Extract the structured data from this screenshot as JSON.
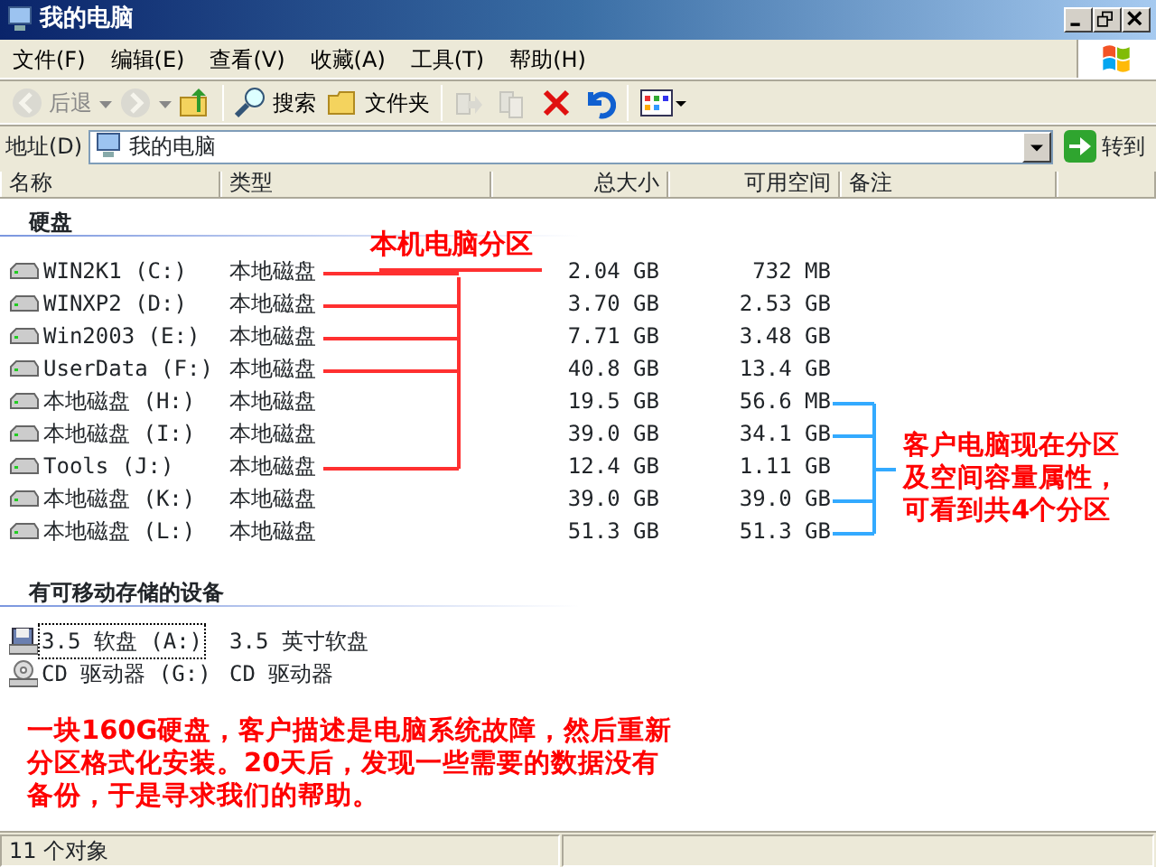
{
  "window": {
    "title": "我的电脑"
  },
  "menu": [
    {
      "label": "文件(F)"
    },
    {
      "label": "编辑(E)"
    },
    {
      "label": "查看(V)"
    },
    {
      "label": "收藏(A)"
    },
    {
      "label": "工具(T)"
    },
    {
      "label": "帮助(H)"
    }
  ],
  "toolbar": [
    {
      "kind": "back",
      "label": "后退",
      "disabled": true
    },
    {
      "kind": "forward",
      "disabled": true
    },
    {
      "kind": "up",
      "disabled": false
    },
    {
      "kind": "search",
      "label": "搜索",
      "disabled": false
    },
    {
      "kind": "folders",
      "label": "文件夹",
      "disabled": false
    },
    {
      "kind": "move",
      "disabled": true
    },
    {
      "kind": "copy",
      "disabled": true
    },
    {
      "kind": "delete",
      "disabled": false
    },
    {
      "kind": "undo",
      "disabled": false
    },
    {
      "kind": "views",
      "disabled": false
    }
  ],
  "address": {
    "label": "地址(D)",
    "value": "我的电脑",
    "go": "转到"
  },
  "columns": [
    "名称",
    "类型",
    "总大小",
    "可用空间",
    "备注"
  ],
  "groups": [
    {
      "title": "硬盘",
      "items": [
        {
          "kind": "disk",
          "name": "WIN2K1 (C:)",
          "type": "本地磁盘",
          "total": "2.04 GB",
          "free": "732 MB",
          "focused": false,
          "partition_line": true,
          "bracket_line": false
        },
        {
          "kind": "disk",
          "name": "WINXP2 (D:)",
          "type": "本地磁盘",
          "total": "3.70 GB",
          "free": "2.53 GB",
          "focused": false,
          "partition_line": true,
          "bracket_line": false
        },
        {
          "kind": "disk",
          "name": "Win2003 (E:)",
          "type": "本地磁盘",
          "total": "7.71 GB",
          "free": "3.48 GB",
          "focused": false,
          "partition_line": true,
          "bracket_line": false
        },
        {
          "kind": "disk",
          "name": "UserData (F:)",
          "type": "本地磁盘",
          "total": "40.8 GB",
          "free": "13.4 GB",
          "focused": false,
          "partition_line": true,
          "bracket_line": false
        },
        {
          "kind": "disk",
          "name": "本地磁盘 (H:)",
          "type": "本地磁盘",
          "total": "19.5 GB",
          "free": "56.6 MB",
          "focused": false,
          "partition_line": false,
          "bracket_line": true
        },
        {
          "kind": "disk",
          "name": "本地磁盘 (I:)",
          "type": "本地磁盘",
          "total": "39.0 GB",
          "free": "34.1 GB",
          "focused": false,
          "partition_line": false,
          "bracket_line": true
        },
        {
          "kind": "disk",
          "name": "Tools (J:)",
          "type": "本地磁盘",
          "total": "12.4 GB",
          "free": "1.11 GB",
          "focused": false,
          "partition_line": true,
          "bracket_line": false
        },
        {
          "kind": "disk",
          "name": "本地磁盘 (K:)",
          "type": "本地磁盘",
          "total": "39.0 GB",
          "free": "39.0 GB",
          "focused": false,
          "partition_line": false,
          "bracket_line": true
        },
        {
          "kind": "disk",
          "name": "本地磁盘 (L:)",
          "type": "本地磁盘",
          "total": "51.3 GB",
          "free": "51.3 GB",
          "focused": false,
          "partition_line": false,
          "bracket_line": true
        }
      ]
    },
    {
      "title": "有可移动存储的设备",
      "items": [
        {
          "kind": "floppy",
          "name": "3.5 软盘 (A:)",
          "type": "3.5 英寸软盘",
          "focused": true
        },
        {
          "kind": "cd",
          "name": "CD 驱动器 (G:)",
          "type": "CD 驱动器",
          "focused": false
        }
      ]
    }
  ],
  "annotations": {
    "partitions_label": "本机电脑分区",
    "current_label": "客户电脑现在分区及空间容量属性，可看到共**4**个分区",
    "description": "一块**160G**硬盘，客户描述是电脑系统故障，然后重新分区格式化安装。**20**天后，发现一些需要的数据没有备份，于是寻求我们的帮助。"
  },
  "status": "11 个对象"
}
